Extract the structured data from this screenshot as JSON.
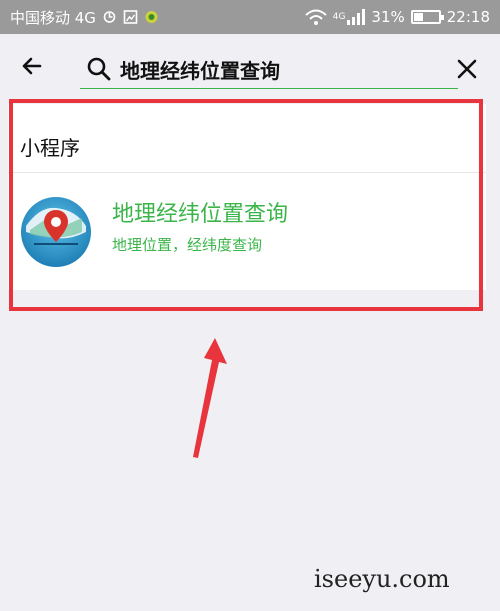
{
  "status_bar": {
    "carrier": "中国移动 4G",
    "network": "4G",
    "battery": "31%",
    "time": "22:18"
  },
  "search": {
    "query": "地理经纬位置查询",
    "back_icon": "back-arrow-icon",
    "search_icon": "magnifier-icon",
    "clear_icon": "close-icon"
  },
  "results": {
    "section_title": "小程序",
    "items": [
      {
        "name": "地理经纬位置查询",
        "description": "地理位置，经纬度查询",
        "icon": "map-pin-globe-icon"
      }
    ]
  },
  "colors": {
    "accent_green": "#3bb54a",
    "highlight_red": "#e8353d",
    "background": "#efeff4"
  },
  "watermark": "iseeyu.com"
}
